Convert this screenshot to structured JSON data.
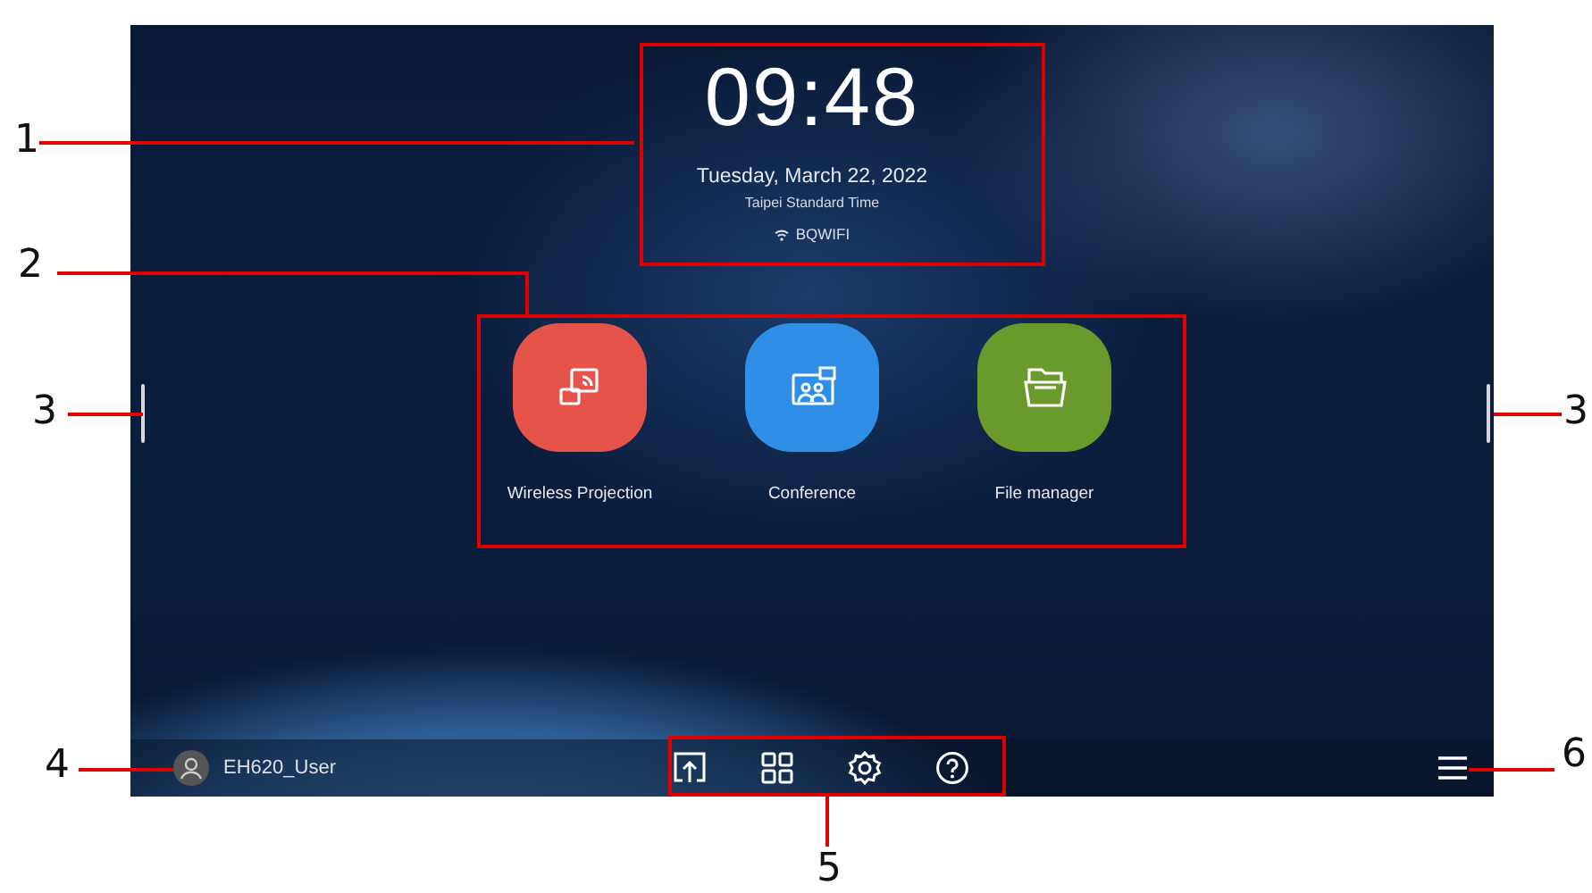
{
  "clock": {
    "time": "09:48",
    "date": "Tuesday, March 22, 2022",
    "timezone": "Taipei Standard Time",
    "network": "BQWIFI"
  },
  "apps": [
    {
      "label": "Wireless Projection",
      "kind": "cast",
      "color": "#e5534b"
    },
    {
      "label": "Conference",
      "kind": "conference",
      "color": "#2f8fe6"
    },
    {
      "label": "File manager",
      "kind": "folder",
      "color": "#6a9a2c"
    }
  ],
  "user": {
    "name": "EH620_User"
  },
  "dock": [
    {
      "kind": "upload"
    },
    {
      "kind": "apps"
    },
    {
      "kind": "settings"
    },
    {
      "kind": "help"
    }
  ],
  "callouts": [
    {
      "label": "1"
    },
    {
      "label": "2"
    },
    {
      "label": "3"
    },
    {
      "label": "3"
    },
    {
      "label": "4"
    },
    {
      "label": "5"
    },
    {
      "label": "6"
    }
  ]
}
